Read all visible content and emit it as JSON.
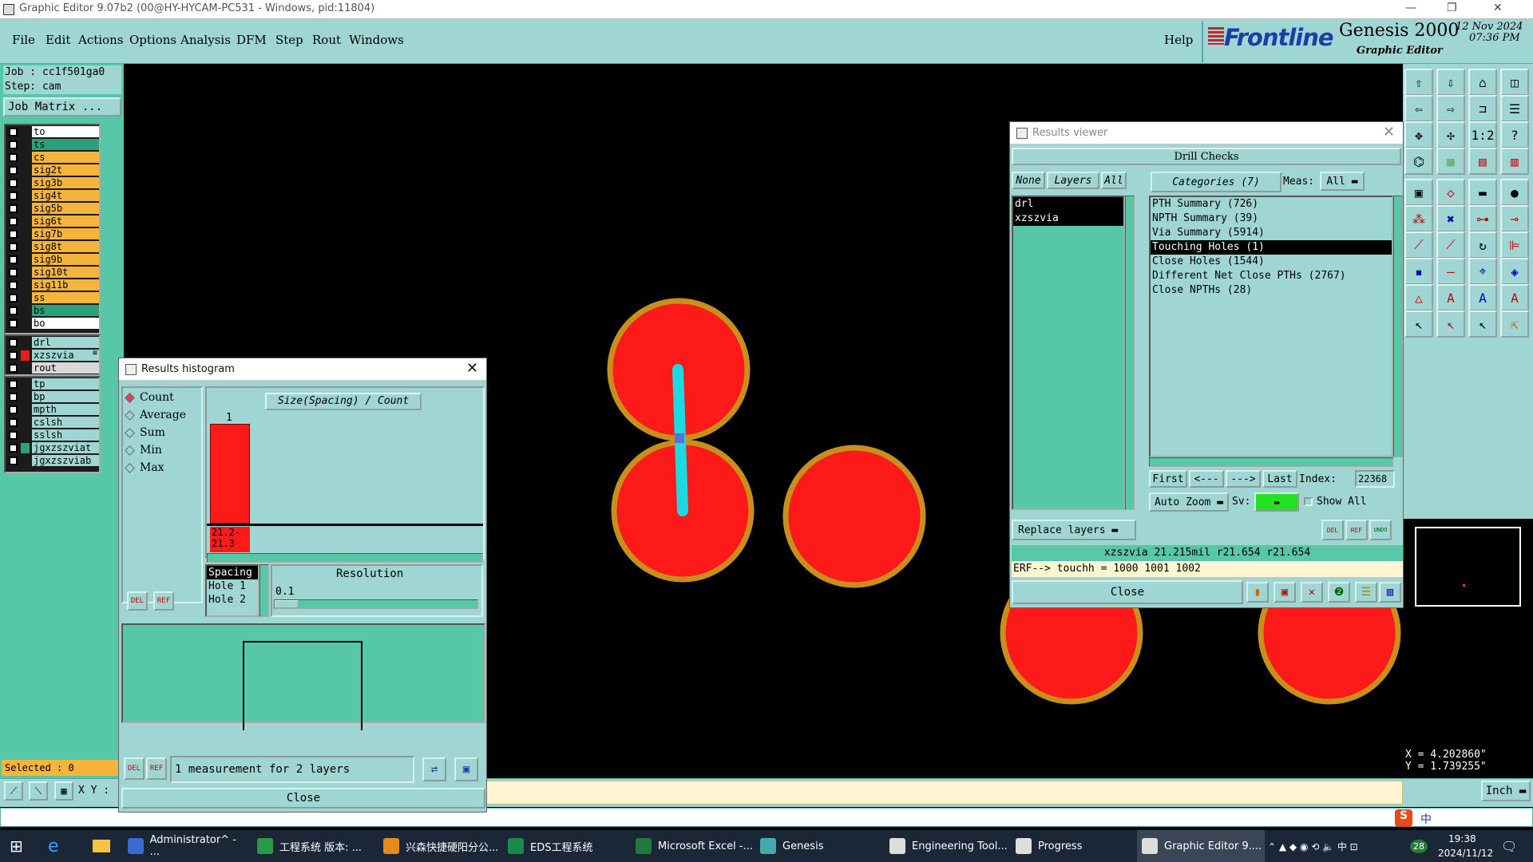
{
  "window": {
    "title": "Graphic Editor 9.07b2 (00@HY-HYCAM-PC531 - Windows, pid:11804)",
    "min": "—",
    "max": "❐",
    "close": "✕"
  },
  "menu": {
    "items": [
      "File",
      "Edit",
      "Actions",
      "Options",
      "Analysis",
      "DFM",
      "Step",
      "Rout",
      "Windows"
    ],
    "help": "Help"
  },
  "brand": {
    "logo": "Frontline",
    "product": "Genesis 2000",
    "subtitle": "Graphic Editor",
    "date": "12 Nov 2024",
    "time": "07:36 PM"
  },
  "left": {
    "job": "Job : cc1f501ga0",
    "step": "Step: cam",
    "job_matrix": "Job Matrix ...",
    "layers_top": [
      {
        "name": "to",
        "color": "#ffffff"
      },
      {
        "name": "ts",
        "color": "#2aa37a"
      },
      {
        "name": "cs",
        "color": "#f5b43c"
      },
      {
        "name": "sig2t",
        "color": "#f5b43c"
      },
      {
        "name": "sig3b",
        "color": "#f5b43c"
      },
      {
        "name": "sig4t",
        "color": "#f5b43c"
      },
      {
        "name": "sig5b",
        "color": "#f5b43c"
      },
      {
        "name": "sig6t",
        "color": "#f5b43c"
      },
      {
        "name": "sig7b",
        "color": "#f5b43c"
      },
      {
        "name": "sig8t",
        "color": "#f5b43c"
      },
      {
        "name": "sig9b",
        "color": "#f5b43c"
      },
      {
        "name": "sig10t",
        "color": "#f5b43c"
      },
      {
        "name": "sig11b",
        "color": "#f5b43c"
      },
      {
        "name": "ss",
        "color": "#f5b43c"
      },
      {
        "name": "bs",
        "color": "#2aa37a"
      },
      {
        "name": "bo",
        "color": "#ffffff"
      }
    ],
    "layers_mid": [
      {
        "name": "drl",
        "color": "#9fd6d4",
        "swatch": "#1b1b1b"
      },
      {
        "name": "xzszvia",
        "color": "#9fd6d4",
        "swatch": "#e81c1c",
        "mark": "≡"
      },
      {
        "name": "rout",
        "color": "#d9d9d9",
        "swatch": "#1b1b1b"
      }
    ],
    "layers_bot": [
      {
        "name": "tp",
        "color": "#9fd6d4",
        "swatch": "#1b1b1b"
      },
      {
        "name": "bp",
        "color": "#9fd6d4",
        "swatch": "#1b1b1b"
      },
      {
        "name": "mpth",
        "color": "#9fd6d4",
        "swatch": "#1b1b1b"
      },
      {
        "name": "cslsh",
        "color": "#9fd6d4",
        "swatch": "#1b1b1b"
      },
      {
        "name": "sslsh",
        "color": "#9fd6d4",
        "swatch": "#1b1b1b"
      },
      {
        "name": "jgxzszviat",
        "color": "#9fd6d4",
        "swatch": "#2aa37a"
      },
      {
        "name": "jgxzszviab",
        "color": "#9fd6d4",
        "swatch": "#1b1b1b"
      }
    ],
    "selected": "Selected : 0",
    "xy_label": "X Y :"
  },
  "histogram": {
    "title": "Results histogram",
    "modes": [
      "Count",
      "Average",
      "Sum",
      "Min",
      "Max"
    ],
    "selected_mode": "Count",
    "chart_title": "Size(Spacing) / Count",
    "bar_count": "1",
    "bar_value": 1,
    "bar_label": "21.2-\n21.3",
    "spacing_items": [
      "Spacing",
      "Hole 1",
      "Hole 2"
    ],
    "resolution_label": "Resolution",
    "resolution_value": "0.1",
    "status": "1 measurement for 2 layers",
    "close": "Close",
    "del": "DEL",
    "ref": "REF"
  },
  "results": {
    "title": "Results viewer",
    "header": "Drill Checks",
    "none": "None",
    "layers": "Layers",
    "all": "All",
    "categories_btn": "Categories (7)",
    "meas_label": "Meas:",
    "meas_value": "All",
    "layer_list": [
      "drl",
      "xzszvia"
    ],
    "categories": [
      "PTH Summary (726)",
      "NPTH Summary (39)",
      "Via Summary (5914)",
      "Touching Holes (1)",
      "Close Holes (1544)",
      "Different Net Close PTHs (2767)",
      "Close NPTHs (28)"
    ],
    "selected_category": "Touching Holes (1)",
    "first": "First",
    "prev": "<---",
    "next": "--->",
    "last": "Last",
    "index_label": "Index:",
    "index_value": "22368",
    "auto_zoom": "Auto Zoom",
    "sv_label": "Sv:",
    "show_all": "Show All",
    "replace_layers": "Replace layers",
    "info_line": "xzszvia 21.215mil  r21.654  r21.654",
    "erf_line": "ERF--> touchh = 1000 1001 1002",
    "close": "Close"
  },
  "coords": {
    "x": "X = 4.202860\"",
    "y": "Y = 1.739255\""
  },
  "units": "Inch",
  "taskbar": {
    "items": [
      "Administrator^ - ...",
      "工程系统 版本: ...",
      "兴森快捷硬阳分公...",
      "EDS工程系统",
      "Microsoft Excel -...",
      "Genesis",
      "Engineering Tool...",
      "Progress",
      "Graphic Editor 9...."
    ],
    "clock_time": "19:38",
    "clock_date": "2024/11/12",
    "ime": "中",
    "badge": "2",
    "tray_num": "28"
  },
  "colors": {
    "panel": "#9fd6d4",
    "green": "#56c8a8",
    "pad_fill": "#ff1a1a",
    "pad_ring": "#c8901a",
    "connector": "#1ad9e0",
    "canvas": "#000000"
  }
}
